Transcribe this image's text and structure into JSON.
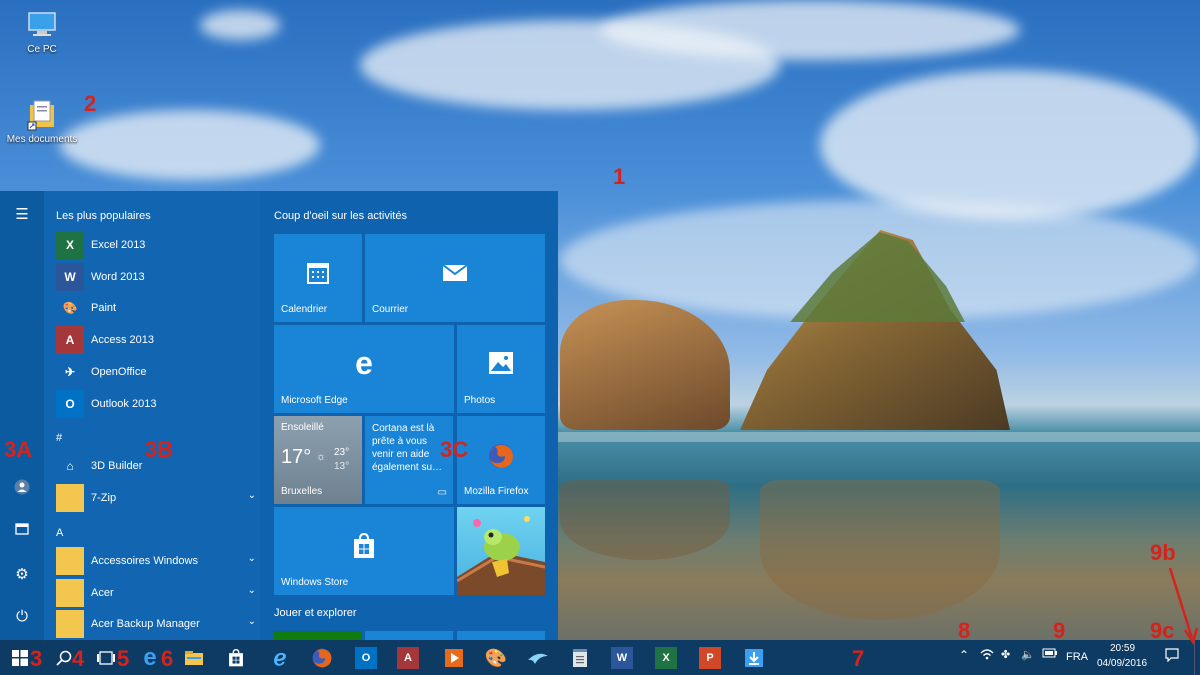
{
  "desktop": {
    "icons": [
      {
        "label": "Ce PC"
      },
      {
        "label": "Mes documents"
      }
    ],
    "annotations": [
      "1",
      "2",
      "3A",
      "3B",
      "3C",
      "3",
      "4",
      "5",
      "6",
      "7",
      "8",
      "9",
      "9b",
      "9c"
    ]
  },
  "start_menu": {
    "most_used_heading": "Les plus populaires",
    "most_used": [
      {
        "label": "Excel 2013",
        "icon": "excel-icon",
        "color": "#1f7244",
        "glyph": "X"
      },
      {
        "label": "Word 2013",
        "icon": "word-icon",
        "color": "#2b579a",
        "glyph": "W"
      },
      {
        "label": "Paint",
        "icon": "paint-icon",
        "color": "#1165b1",
        "glyph": "🎨"
      },
      {
        "label": "Access 2013",
        "icon": "access-icon",
        "color": "#a4373a",
        "glyph": "A"
      },
      {
        "label": "OpenOffice",
        "icon": "openoffice-icon",
        "color": "#1165b1",
        "glyph": "✈"
      },
      {
        "label": "Outlook 2013",
        "icon": "outlook-icon",
        "color": "#0072c6",
        "glyph": "O"
      }
    ],
    "section_hash": "#",
    "hash_items": [
      {
        "label": "3D Builder",
        "icon": "3d-builder-icon",
        "color": "#1165b1",
        "glyph": "⌂"
      },
      {
        "label": "7-Zip",
        "icon": "folder-icon",
        "color": "#f3c650",
        "glyph": "",
        "chevron": "⌄"
      }
    ],
    "section_a": "A",
    "a_items": [
      {
        "label": "Accessoires Windows",
        "icon": "folder-icon",
        "color": "#f3c650",
        "glyph": "",
        "chevron": "⌄"
      },
      {
        "label": "Acer",
        "icon": "folder-icon",
        "color": "#f3c650",
        "glyph": "",
        "chevron": "⌄"
      },
      {
        "label": "Acer Backup Manager",
        "icon": "folder-icon",
        "color": "#f3c650",
        "glyph": "",
        "chevron": "⌄"
      }
    ],
    "tiles_heading": "Coup d'oeil sur les activités",
    "tiles": {
      "calendar": "Calendrier",
      "mail": "Courrier",
      "edge": "Microsoft Edge",
      "photos": "Photos",
      "weather": {
        "condition": "Ensoleillé",
        "temp": "17°",
        "high": "23°",
        "low": "13°",
        "city": "Bruxelles"
      },
      "cortana": "Cortana est là prête à vous venir en aide également su…",
      "firefox": "Mozilla Firefox",
      "store": "Windows Store"
    },
    "play_heading": "Jouer et explorer"
  },
  "taskbar": {
    "lang": "FRA",
    "time": "20:59",
    "date": "04/09/2016"
  },
  "colors": {
    "accent": "#1a84d6",
    "taskbar": "#0e3b63",
    "annotation": "#d4231c"
  }
}
